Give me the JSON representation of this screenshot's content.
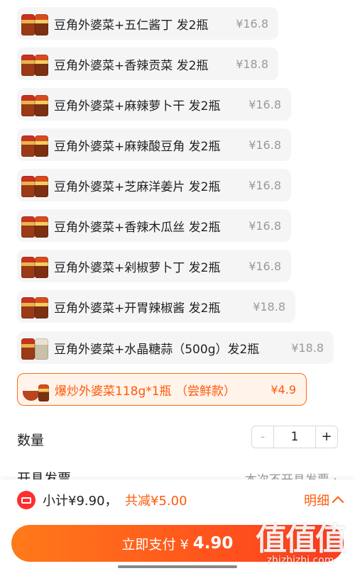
{
  "options": [
    {
      "name": "豆角外婆菜+五仁酱丁 发2瓶",
      "price": "¥16.8"
    },
    {
      "name": "豆角外婆菜+香辣贡菜 发2瓶",
      "price": "¥18.8"
    },
    {
      "name": "豆角外婆菜+麻辣萝卜干 发2瓶",
      "price": "¥16.8"
    },
    {
      "name": "豆角外婆菜+麻辣酸豆角 发2瓶",
      "price": "¥16.8"
    },
    {
      "name": "豆角外婆菜+芝麻洋姜片 发2瓶",
      "price": "¥16.8"
    },
    {
      "name": "豆角外婆菜+香辣木瓜丝 发2瓶",
      "price": "¥16.8"
    },
    {
      "name": "豆角外婆菜+剁椒萝卜丁 发2瓶",
      "price": "¥16.8"
    },
    {
      "name": "豆角外婆菜+开胃辣椒酱  发2瓶",
      "price": "¥18.8"
    },
    {
      "name": "豆角外婆菜+水晶糖蒜（500g）发2瓶",
      "price": "¥18.8"
    },
    {
      "name": "爆炒外婆菜118g*1瓶 （尝鲜款）",
      "price": "¥4.9",
      "selected": true
    }
  ],
  "quantity": {
    "label": "数量",
    "minus": "-",
    "value": "1",
    "plus": "+"
  },
  "invoice": {
    "label": "开具发票",
    "value": "本次不开具发票 ›"
  },
  "summary": {
    "subtotal": "小计¥9.90，",
    "discount": "共减¥5.00",
    "detail": "明细"
  },
  "pay": {
    "label": "立即支付 ¥",
    "amount": "4.90"
  },
  "watermark": {
    "big": "值值值",
    "small": "zhizhizhi.com"
  },
  "colors": {
    "accent": "#ff5a0a",
    "gradient_start": "#ff7a1a",
    "gradient_end": "#ff3b1f"
  }
}
